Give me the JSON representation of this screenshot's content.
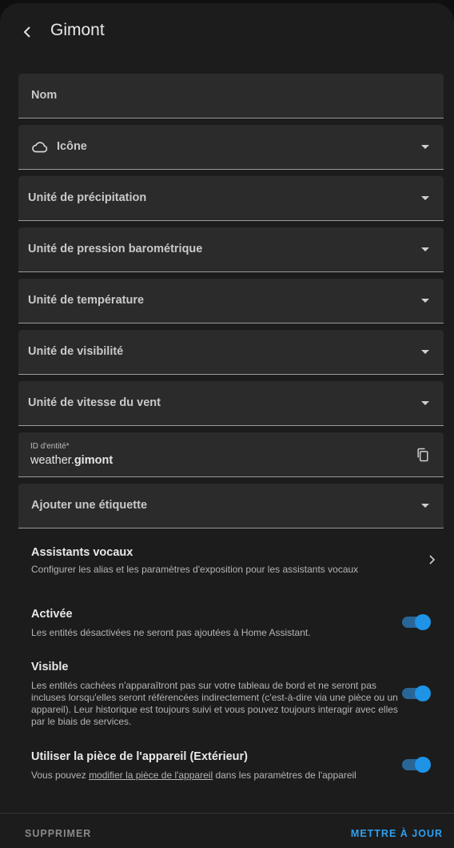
{
  "header": {
    "title": "Gimont"
  },
  "fields": {
    "name_placeholder": "Nom",
    "icon_label": "Icône",
    "precipitation_label": "Unité de précipitation",
    "pressure_label": "Unité de pression barométrique",
    "temperature_label": "Unité de température",
    "visibility_label": "Unité de visibilité",
    "wind_label": "Unité de vitesse du vent",
    "entity_id_label": "ID d'entité*",
    "entity_id_domain": "weather.",
    "entity_id_object": "gimont",
    "labels_label": "Ajouter une étiquette"
  },
  "voice": {
    "title": "Assistants vocaux",
    "description": "Configurer les alias et les paramètres d'exposition pour les assistants vocaux"
  },
  "enabled": {
    "title": "Activée",
    "description": "Les entités désactivées ne seront pas ajoutées à Home Assistant.",
    "on": true
  },
  "visible": {
    "title": "Visible",
    "description": "Les entités cachées n'apparaîtront pas sur votre tableau de bord et ne seront pas incluses lorsqu'elles seront référencées indirectement (c'est-à-dire via une pièce ou un appareil). Leur historique est toujours suivi et vous pouvez toujours interagir avec elles par le biais de services.",
    "on": true
  },
  "area": {
    "title": "Utiliser la pièce de l'appareil (Extérieur)",
    "desc_prefix": "Vous pouvez ",
    "desc_link": "modifier la pièce de l'appareil",
    "desc_suffix": " dans les paramètres de l'appareil",
    "on": true
  },
  "footer": {
    "delete_label": "SUPPRIMER",
    "update_label": "METTRE À JOUR"
  },
  "colors": {
    "accent": "#1f93e6",
    "surface": "#1c1c1c",
    "field": "#2b2b2b"
  },
  "icons": [
    "chevron-left-icon",
    "cloud-icon",
    "caret-down-icon",
    "copy-icon",
    "chevron-right-icon"
  ]
}
